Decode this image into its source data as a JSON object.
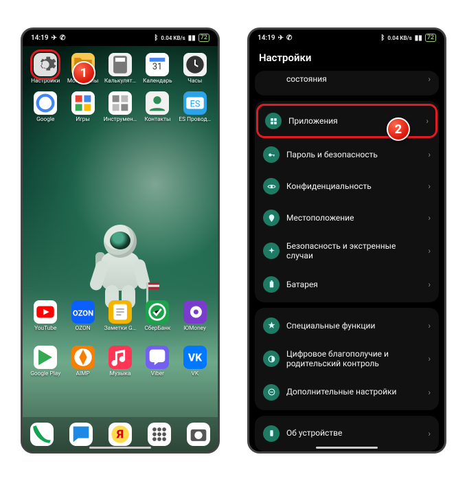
{
  "status": {
    "time": "14:19",
    "net_speed": "0.04 KB/s",
    "battery": "72"
  },
  "callouts": {
    "one": "1",
    "two": "2"
  },
  "homescreen": {
    "top_apps": [
      {
        "label": "Настройки",
        "icon": "gear",
        "bg": "#e0e0e0",
        "highlight": true
      },
      {
        "label": "Мои файлы",
        "icon": "folder",
        "bg": "#f9c74f"
      },
      {
        "label": "Калькулят…",
        "icon": "calc",
        "bg": "#f1f1f1"
      },
      {
        "label": "Календарь",
        "icon": "calendar",
        "bg": "#ffffff"
      },
      {
        "label": "Часы",
        "icon": "clock",
        "bg": "#f1f1f1"
      },
      {
        "label": "Google",
        "icon": "google",
        "bg": "#ffffff"
      },
      {
        "label": "Игры",
        "icon": "games",
        "bg": "#fefefe"
      },
      {
        "label": "Инструмен…",
        "icon": "tools",
        "bg": "#fefefe"
      },
      {
        "label": "Контакты",
        "icon": "contacts",
        "bg": "#f1f1f1"
      },
      {
        "label": "ES Провод…",
        "icon": "es",
        "bg": "#2aa3e8"
      }
    ],
    "bottom_apps": [
      {
        "label": "YouTube",
        "icon": "youtube",
        "bg": "#ffffff"
      },
      {
        "label": "OZON",
        "icon": "ozon",
        "bg": "#0b5fff"
      },
      {
        "label": "Заметки G…",
        "icon": "notes",
        "bg": "#f4b400"
      },
      {
        "label": "СберБанк",
        "icon": "sber",
        "bg": "#1aa34a"
      },
      {
        "label": "ЮMoney",
        "icon": "yoomoney",
        "bg": "#7a3ccc"
      },
      {
        "label": "",
        "icon": "",
        "bg": ""
      },
      {
        "label": "",
        "icon": "",
        "bg": ""
      },
      {
        "label": "",
        "icon": "",
        "bg": ""
      },
      {
        "label": "",
        "icon": "",
        "bg": ""
      },
      {
        "label": "",
        "icon": "",
        "bg": ""
      },
      {
        "label": "Google Play",
        "icon": "play",
        "bg": "#ffffff"
      },
      {
        "label": "AIMP",
        "icon": "aimp",
        "bg": "#f67e00"
      },
      {
        "label": "Музыка",
        "icon": "music",
        "bg": "#ff3556"
      },
      {
        "label": "Viber",
        "icon": "viber",
        "bg": "#7360f2"
      },
      {
        "label": "VK",
        "icon": "vk",
        "bg": "#0077ff"
      }
    ],
    "dock": [
      {
        "name": "phone",
        "bg": "#ffffff"
      },
      {
        "name": "sms",
        "bg": "#ffffff"
      },
      {
        "name": "yandex",
        "bg": "#ffffff"
      },
      {
        "name": "drawer",
        "bg": "#ffffff"
      },
      {
        "name": "camera",
        "bg": "#ffffff"
      }
    ]
  },
  "settings": {
    "title": "Настройки",
    "groups": [
      [
        {
          "label": "состояния",
          "icon": "status",
          "partial": true
        }
      ],
      [
        {
          "label": "Приложения",
          "icon": "apps",
          "highlight": true
        },
        {
          "label": "Пароль и безопасность",
          "icon": "key"
        },
        {
          "label": "Конфиденциальность",
          "icon": "privacy"
        },
        {
          "label": "Местоположение",
          "icon": "location"
        },
        {
          "label": "Безопасность и экстренные\nслучаи",
          "icon": "emergency"
        },
        {
          "label": "Батарея",
          "icon": "battery"
        }
      ],
      [
        {
          "label": "Специальные функции",
          "icon": "star"
        },
        {
          "label": "Цифровое благополучие и\nродительский контроль",
          "icon": "wellbeing"
        },
        {
          "label": "Дополнительные настройки",
          "icon": "more"
        }
      ],
      [
        {
          "label": "Об устройстве",
          "icon": "about"
        }
      ]
    ]
  }
}
